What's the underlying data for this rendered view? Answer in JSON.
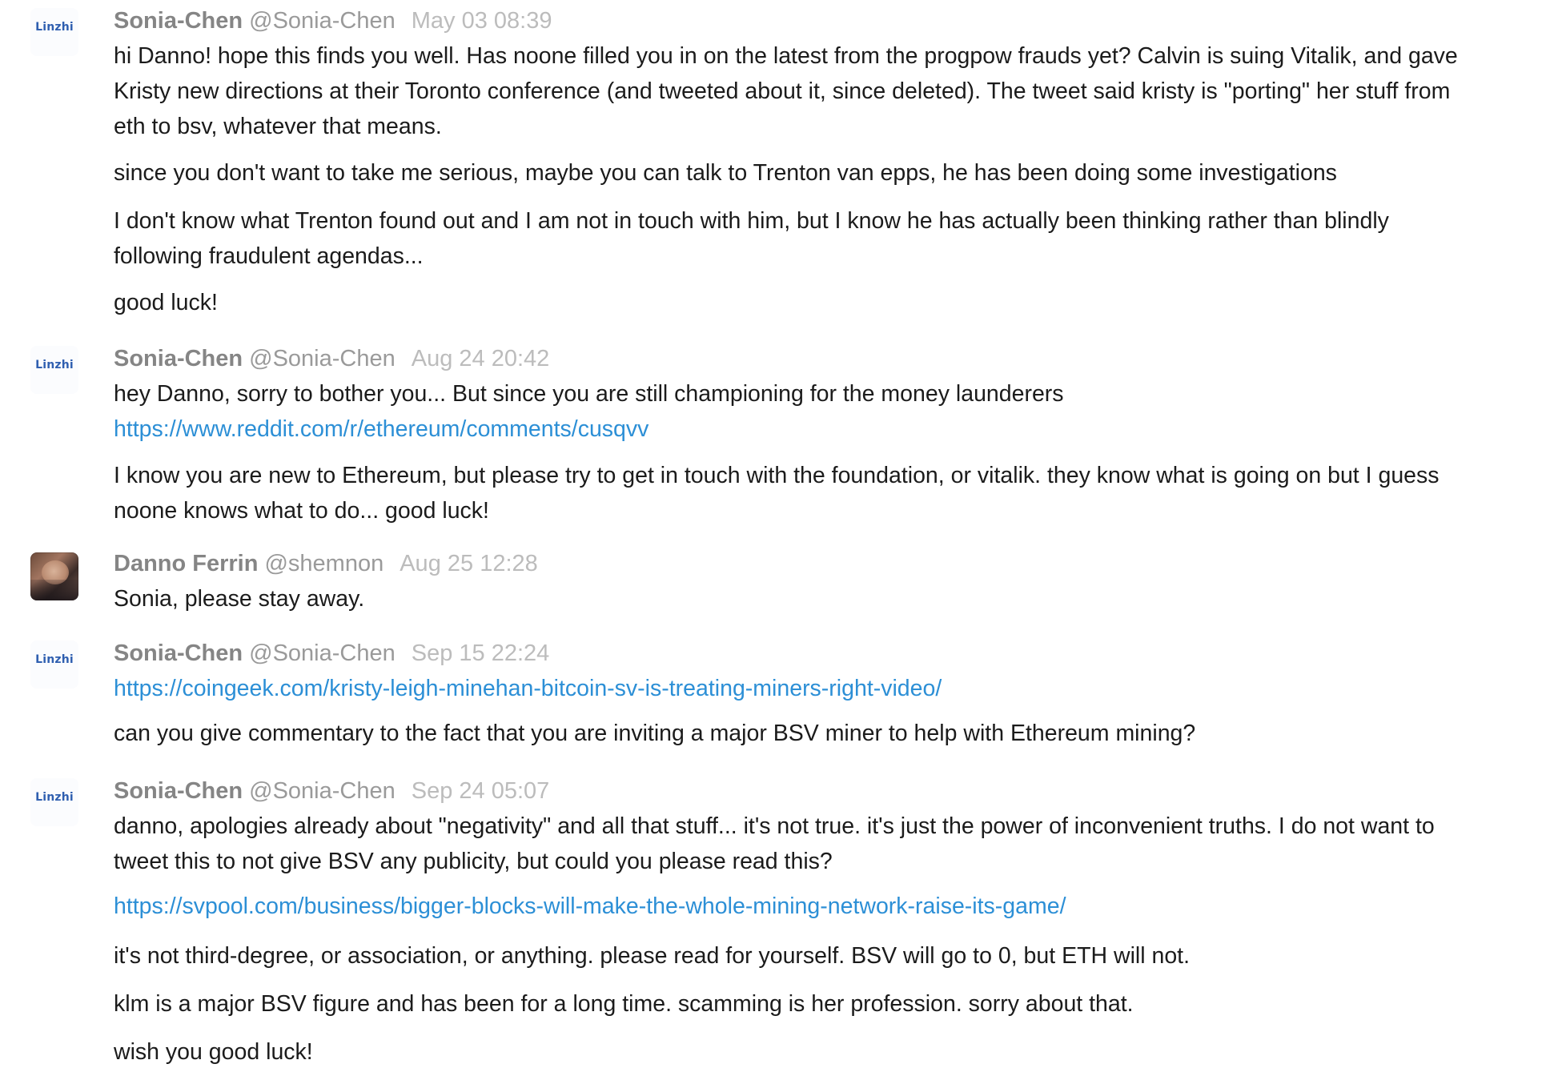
{
  "messages": [
    {
      "avatar_label": "Linzhi",
      "name": "Sonia-Chen",
      "handle": "@Sonia-Chen",
      "time": "May 03 08:39",
      "lines": [
        "hi Danno! hope this finds you well. Has noone filled you in on the latest from the progpow frauds yet? Calvin is suing Vitalik, and gave",
        "Kristy new directions at their Toronto conference (and tweeted about it, since deleted). The tweet said kristy is \"porting\" her stuff from",
        "eth to bsv, whatever that means.",
        "since you don't want to take me serious, maybe you can talk to Trenton van epps, he has been doing some investigations",
        "I don't know what Trenton found out and I am not in touch with him, but I know he has actually been thinking rather than blindly",
        "following fraudulent agendas...",
        "good luck!"
      ]
    },
    {
      "avatar_label": "Linzhi",
      "name": "Sonia-Chen",
      "handle": "@Sonia-Chen",
      "time": "Aug 24 20:42",
      "lines": [
        "hey Danno, sorry to bother you... But since you are still championing for the money launderers",
        "https://www.reddit.com/r/ethereum/comments/cusqvv",
        "I know you are new to Ethereum, but please try to get in touch with the foundation, or vitalik. they know what is going on but I guess",
        "noone knows what to do... good luck!"
      ]
    },
    {
      "avatar_label": "",
      "name": "Danno Ferrin",
      "handle": "@shemnon",
      "time": "Aug 25 12:28",
      "lines": [
        "Sonia, please stay away."
      ]
    },
    {
      "avatar_label": "Linzhi",
      "name": "Sonia-Chen",
      "handle": "@Sonia-Chen",
      "time": "Sep 15 22:24",
      "lines": [
        "https://coingeek.com/kristy-leigh-minehan-bitcoin-sv-is-treating-miners-right-video/",
        "can you give commentary to the fact that you are inviting a major BSV miner to help with Ethereum mining?"
      ]
    },
    {
      "avatar_label": "Linzhi",
      "name": "Sonia-Chen",
      "handle": "@Sonia-Chen",
      "time": "Sep 24 05:07",
      "lines": [
        "danno, apologies already about \"negativity\" and all that stuff... it's not true. it's just the power of inconvenient truths. I do not want to",
        "tweet this to not give BSV any publicity, but could you please read this?",
        "https://svpool.com/business/bigger-blocks-will-make-the-whole-mining-network-raise-its-game/",
        "it's not third-degree, or association, or anything. please read for yourself. BSV will go to 0, but ETH will not.",
        "klm is a major BSV figure and has been for a long time. scamming is her profession. sorry about that.",
        "wish you good luck!"
      ]
    }
  ]
}
